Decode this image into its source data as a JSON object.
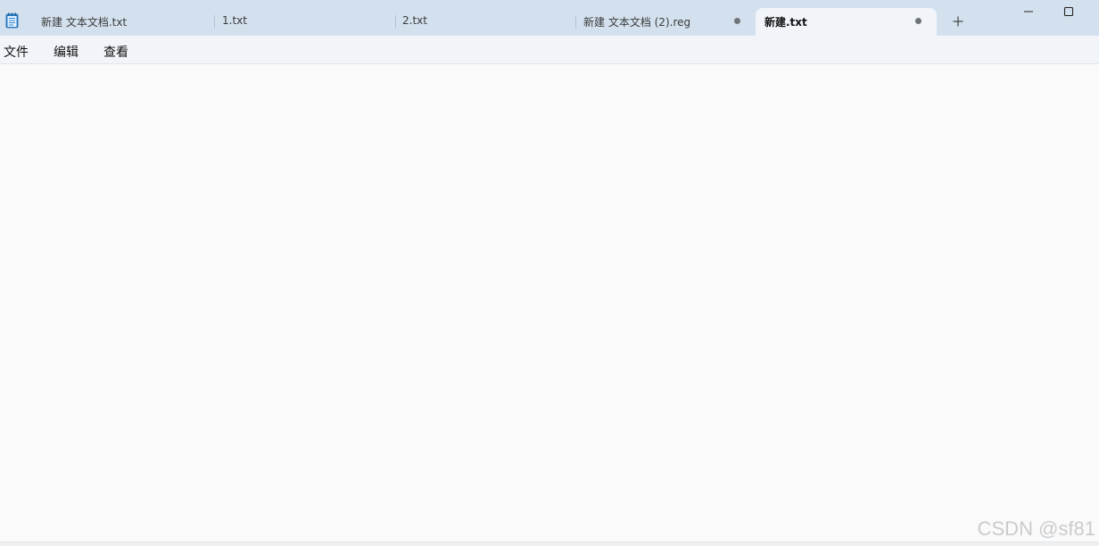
{
  "tabs": [
    {
      "label": "新建 文本文档.txt",
      "unsaved": false,
      "active": false
    },
    {
      "label": "1.txt",
      "unsaved": false,
      "active": false
    },
    {
      "label": "2.txt",
      "unsaved": false,
      "active": false
    },
    {
      "label": "新建 文本文档 (2).reg",
      "unsaved": true,
      "active": false
    },
    {
      "label": "新建.txt",
      "unsaved": true,
      "active": true
    }
  ],
  "menu": {
    "file": "文件",
    "edit": "编辑",
    "view": "查看"
  },
  "icons": {
    "app": "notepad-icon",
    "new_tab": "plus-icon",
    "minimize": "minimize-icon",
    "maximize": "maximize-icon"
  },
  "watermark": "CSDN @sf81",
  "colors": {
    "titlebar": "#d3e1ee",
    "active_tab": "#f1f4f9",
    "menubar": "#f1f5f9",
    "editor": "#fafafa"
  }
}
